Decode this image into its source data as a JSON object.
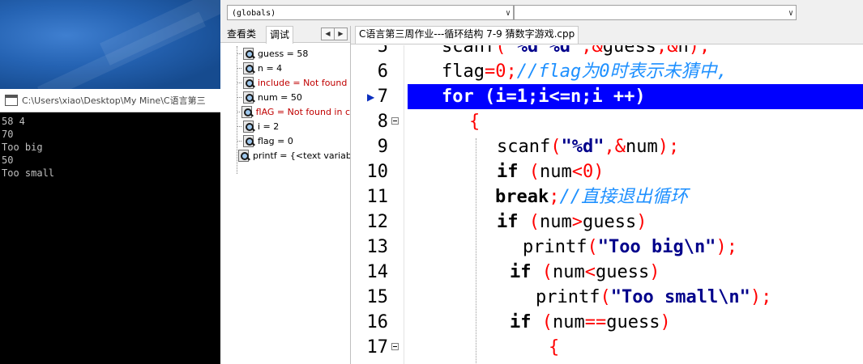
{
  "console": {
    "title": "C:\\Users\\xiao\\Desktop\\My Mine\\C语言第三",
    "output": "58 4\n70\nToo big\n50\nToo small"
  },
  "toolbar": {
    "globals_combo": "(globals)",
    "second_combo": ""
  },
  "left_panel": {
    "tabs": [
      "查看类",
      "调试"
    ],
    "watch_items": [
      {
        "text": "guess = 58",
        "error": false
      },
      {
        "text": "n = 4",
        "error": false
      },
      {
        "text": "include = Not found",
        "error": true
      },
      {
        "text": "num = 50",
        "error": false
      },
      {
        "text": "flAG = Not found in c",
        "error": true
      },
      {
        "text": "i = 2",
        "error": false
      },
      {
        "text": "flag = 0",
        "error": false
      },
      {
        "text": "printf = {<text variab",
        "error": false
      }
    ]
  },
  "editor": {
    "file_tab": "C语言第三周作业---循环结构 7-9 猜数字游戏.cpp",
    "current_line": 7,
    "lines": [
      {
        "num": "5",
        "code": "scanf(\"%d %d\",&guess,&n);"
      },
      {
        "num": "6",
        "code": "flag=0;//flag为0时表示未猜中,"
      },
      {
        "num": "7",
        "code": "for (i=1;i<=n;i ++)"
      },
      {
        "num": "8",
        "code": "{"
      },
      {
        "num": "9",
        "code": "scanf(\"%d\",&num);"
      },
      {
        "num": "10",
        "code": "if (num<0)"
      },
      {
        "num": "11",
        "code": "break;//直接退出循环"
      },
      {
        "num": "12",
        "code": "if (num>guess)"
      },
      {
        "num": "13",
        "code": "printf(\"Too big\\n\");"
      },
      {
        "num": "14",
        "code": "if (num<guess)"
      },
      {
        "num": "15",
        "code": "printf(\"Too small\\n\");"
      },
      {
        "num": "16",
        "code": "if (num==guess)"
      },
      {
        "num": "17",
        "code": "{"
      }
    ]
  },
  "colors": {
    "highlight": "#0000ff",
    "operator": "#ff0000",
    "string": "#00008b",
    "comment": "#1e90ff",
    "error_text": "#c00000"
  }
}
